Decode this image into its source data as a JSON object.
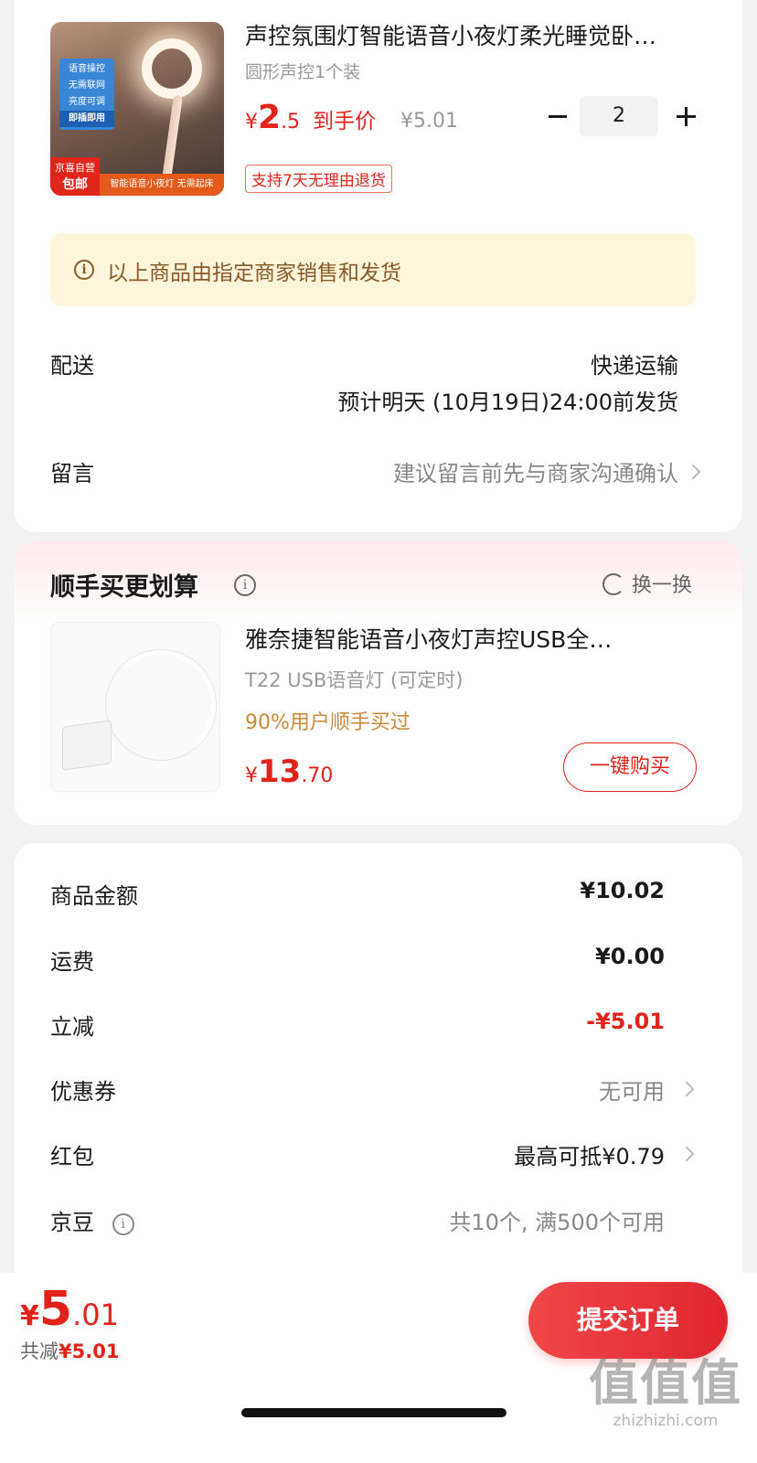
{
  "product": {
    "title": "声控氛围灯智能语音小夜灯柔光睡觉卧…",
    "spec": "圆形声控1个装",
    "price_currency": "¥",
    "price_int": "2",
    "price_dec": ".5",
    "price_label": "到手价",
    "original_price": "¥5.01",
    "quantity": "2",
    "return_badge": "支持7天无理由退货",
    "image_tags": [
      "语音操控",
      "无需联网",
      "亮度可调",
      "即插即用"
    ],
    "image_jd_line1": "京喜自营",
    "image_jd_line2": "包邮",
    "image_strip": "智能语音小夜灯 无需起床"
  },
  "notice": {
    "text": "以上商品由指定商家销售和发货"
  },
  "delivery": {
    "label": "配送",
    "method": "快递运输",
    "estimate": "预计明天 (10月19日)24:00前发货"
  },
  "message": {
    "label": "留言",
    "placeholder": "建议留言前先与商家沟通确认"
  },
  "cross_sell": {
    "title": "顺手买更划算",
    "swap_label": "换一换",
    "name": "雅奈捷智能语音小夜灯声控USB全…",
    "spec": "T22 USB语音灯 (可定时)",
    "social_proof": "90%用户顺手买过",
    "price_currency": "¥",
    "price_int": "13",
    "price_dec": ".70",
    "buy_label": "一键购买"
  },
  "summary": {
    "goods_label": "商品金额",
    "goods_value": "¥10.02",
    "shipping_label": "运费",
    "shipping_value": "¥0.00",
    "discount_label": "立减",
    "discount_value": "-¥5.01",
    "coupon_label": "优惠券",
    "coupon_value": "无可用",
    "redpacket_label": "红包",
    "redpacket_value": "最高可抵¥0.79",
    "beans_label": "京豆",
    "beans_value": "共10个, 满500个可用"
  },
  "bottom": {
    "total_currency": "¥",
    "total_int": "5",
    "total_dec": ".01",
    "saved_label": "共减",
    "saved_value": "¥5.01",
    "submit_label": "提交订单"
  },
  "watermark": {
    "glyphs": "值值值",
    "url": "zhizhizhi.com"
  },
  "colors": {
    "accent": "#e2231a",
    "notice_bg": "#fdf6da",
    "notice_text": "#8a5a28",
    "page_bg": "#f2f2f2"
  }
}
